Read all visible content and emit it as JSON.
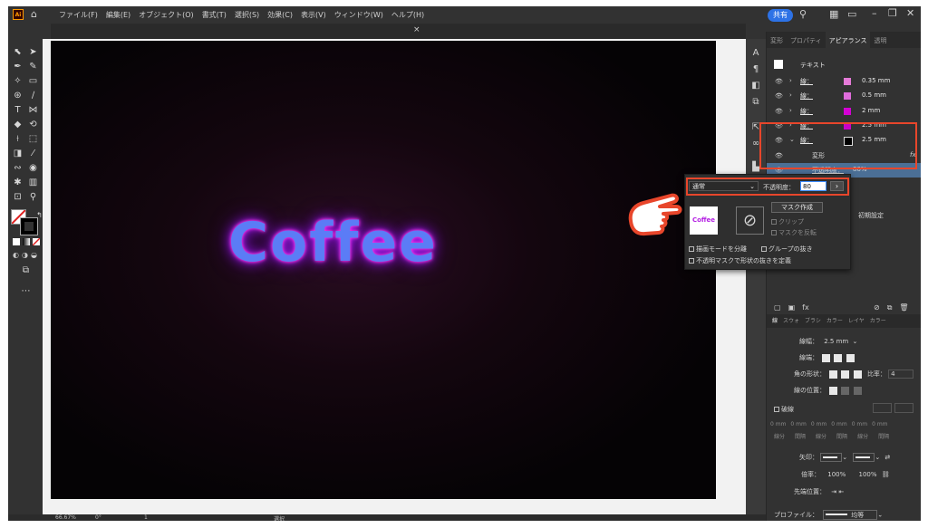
{
  "app": {
    "logo": "Ai"
  },
  "menu": [
    "ファイル(F)",
    "編集(E)",
    "オブジェクト(O)",
    "書式(T)",
    "選択(S)",
    "効果(C)",
    "表示(V)",
    "ウィンドウ(W)",
    "ヘルプ(H)"
  ],
  "topbar": {
    "share_label": "共有"
  },
  "document": {
    "close_label": "×"
  },
  "artboard": {
    "text": "Coffee"
  },
  "status": {
    "zoom": "66.67%",
    "rotation": "0°",
    "page": "1",
    "tool": "選択"
  },
  "panel": {
    "tabs": [
      "変形",
      "プロパティ",
      "アピアランス",
      "透明"
    ],
    "object_label": "テキスト",
    "strokes": [
      {
        "name": "線：",
        "value": "0.35 mm",
        "color": "#e57ad8",
        "expanded": false
      },
      {
        "name": "線：",
        "value": "0.5 mm",
        "color": "#e06ddc",
        "expanded": false
      },
      {
        "name": "線：",
        "value": "2 mm",
        "color": "#d400d4",
        "expanded": false
      },
      {
        "name": "線：",
        "value": "2.5 mm",
        "color": "#c700c7",
        "expanded": false
      },
      {
        "name": "線：",
        "value": "2.5 mm",
        "color": "#000000",
        "expanded": true
      }
    ],
    "transform_label": "変形",
    "fx_label": "fx",
    "opacity_label": "不透明度：",
    "opacity_value": "80%",
    "reset_label": "初期設定"
  },
  "transparency_popup": {
    "blend_mode": "通常",
    "opacity_label": "不透明度：",
    "opacity_value": "80",
    "make_mask_label": "マスク作成",
    "thumb_label": "Coffee",
    "clip_label": "クリップ",
    "invert_label": "マスクを反転",
    "isolate_label": "描画モードを分離",
    "knockout_label": "グループの抜き",
    "define_knockout_label": "不透明マスクで形状の抜きを定義"
  },
  "stroke_panel": {
    "tabs": [
      "線",
      "スウォ",
      "ブラシ",
      "カラー",
      "レイヤ",
      "カラー"
    ],
    "weight_label": "線幅：",
    "weight_value": "2.5 mm",
    "cap_label": "線端：",
    "corner_label": "角の形状：",
    "limit_label": "比率：",
    "limit_value": "4",
    "align_label": "線の位置：",
    "dashed_label": "破線",
    "dash_cells": [
      "0 mm",
      "0 mm",
      "0 mm",
      "0 mm",
      "0 mm",
      "0 mm"
    ],
    "dash_sub": [
      "線分",
      "間隔",
      "線分",
      "間隔",
      "線分",
      "間隔"
    ],
    "arrow_label": "矢印：",
    "scale_label": "倍率：",
    "scale1": "100%",
    "scale2": "100%",
    "arrow_pos_label": "先端位置：",
    "profile_label": "プロファイル：",
    "profile_value": "均等"
  }
}
